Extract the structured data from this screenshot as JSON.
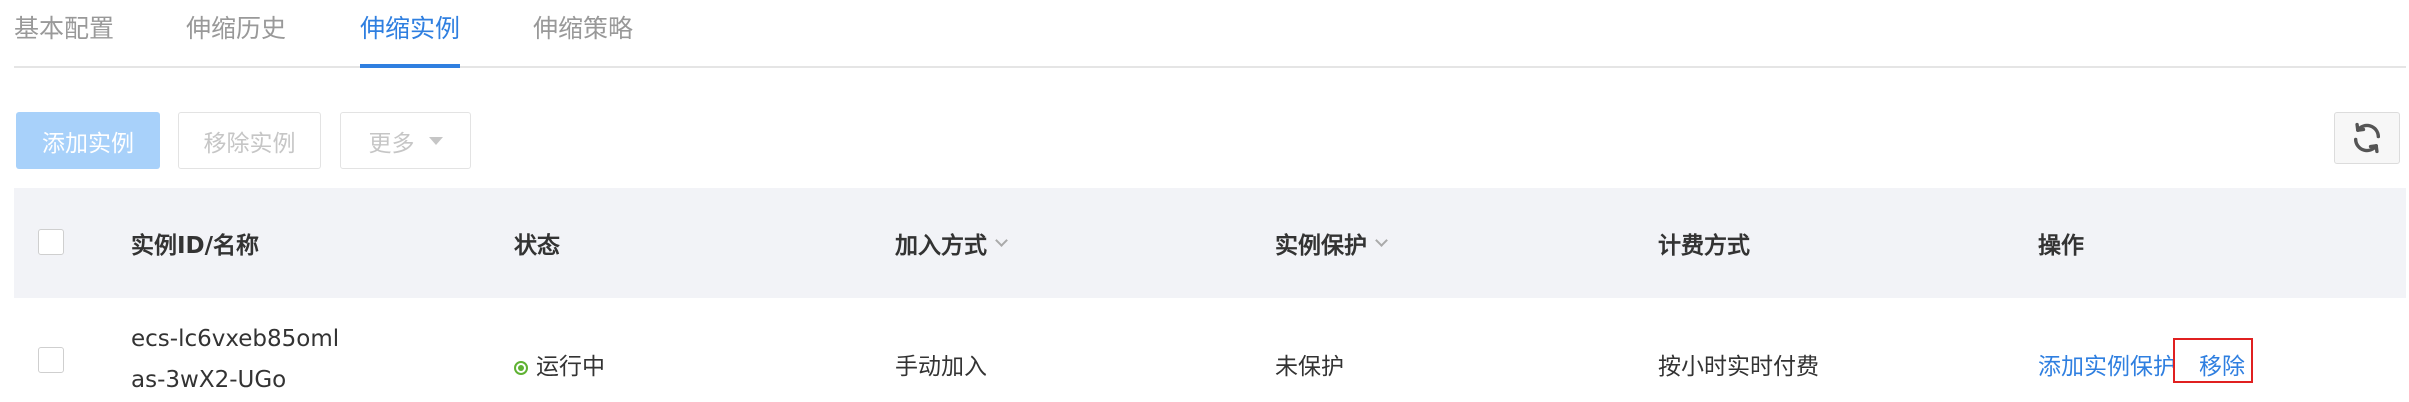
{
  "tabs": [
    {
      "label": "基本配置",
      "active": false
    },
    {
      "label": "伸缩历史",
      "active": false
    },
    {
      "label": "伸缩实例",
      "active": true
    },
    {
      "label": "伸缩策略",
      "active": false
    }
  ],
  "toolbar": {
    "add_label": "添加实例",
    "remove_label": "移除实例",
    "more_label": "更多",
    "refresh_icon": "refresh-icon"
  },
  "table": {
    "columns": [
      {
        "label": "实例ID/名称",
        "sortable": false
      },
      {
        "label": "状态",
        "sortable": false
      },
      {
        "label": "加入方式",
        "sortable": true
      },
      {
        "label": "实例保护",
        "sortable": true
      },
      {
        "label": "计费方式",
        "sortable": false
      },
      {
        "label": "操作",
        "sortable": false
      }
    ],
    "rows": [
      {
        "instance_id": "ecs-lc6vxeb85oml",
        "instance_name": "as-3wX2-UGo",
        "status": "运行中",
        "join_method": "手动加入",
        "protection": "未保护",
        "billing": "按小时实时付费",
        "actions": [
          "添加实例保护",
          "移除"
        ]
      }
    ]
  },
  "colors": {
    "accent": "#2f7fe0",
    "status_running": "#5fb233",
    "highlight": "#e02020"
  }
}
